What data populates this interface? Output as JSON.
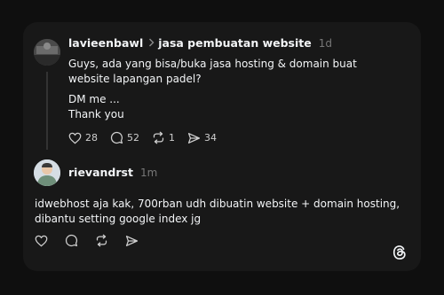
{
  "post": {
    "username": "lavieenbawl",
    "topic": "jasa pembuatan website",
    "time": "1d",
    "paragraph1": "Guys, ada yang bisa/buka jasa hosting & domain buat website lapangan padel?",
    "line2": "DM me ...",
    "line3": "Thank you",
    "stats": {
      "likes": "28",
      "replies": "52",
      "reposts": "1",
      "shares": "34"
    }
  },
  "reply": {
    "username": "rievandrst",
    "time": "1m",
    "text": "idwebhost aja kak, 700rban udh dibuatin website + domain hosting, dibantu setting google index jg"
  },
  "icons": [
    "heart-icon",
    "comment-icon",
    "repost-icon",
    "share-icon",
    "threads-logo-icon",
    "chevron-right-icon"
  ]
}
